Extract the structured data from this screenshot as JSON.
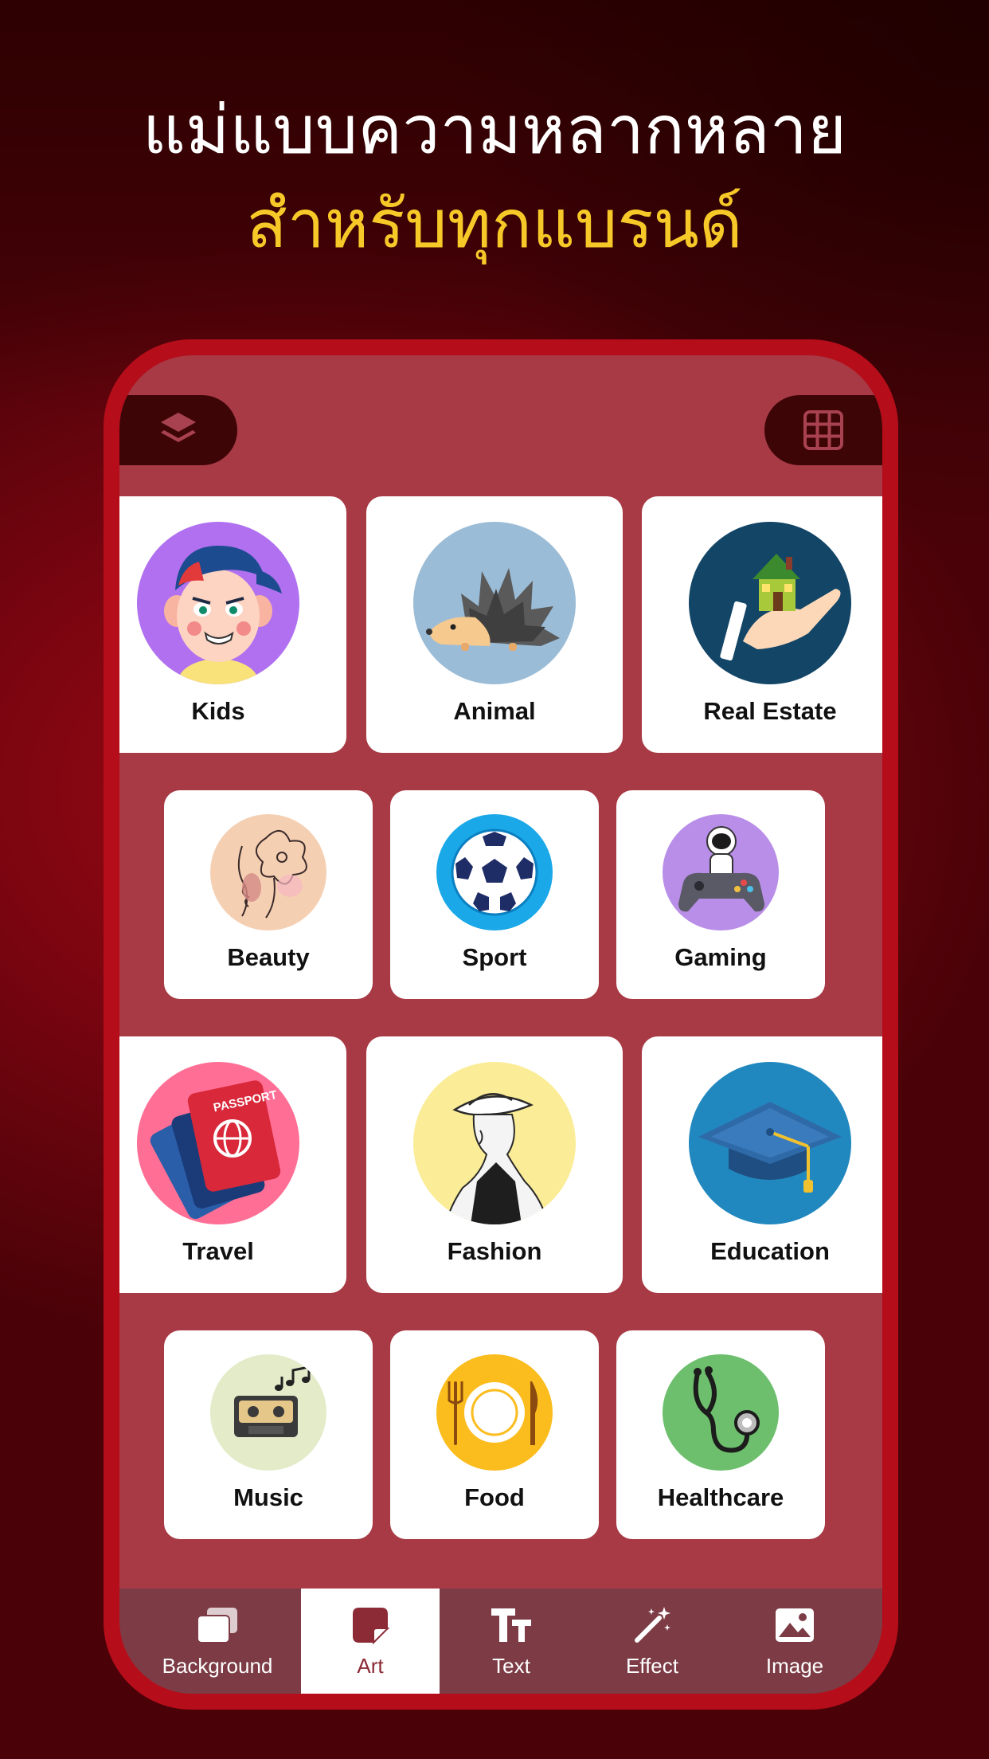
{
  "headline": {
    "line1": "แม่แบบความหลากหลาย",
    "line2": "สำหรับทุกแบรนด์"
  },
  "colors": {
    "accent_yellow": "#f7c928",
    "phone_frame": "#b50d1a",
    "screen": "#a73a45",
    "active_tab_text": "#8c2a36"
  },
  "toolbar": {
    "layers_icon": "layers-icon",
    "grid_icon": "grid-icon"
  },
  "categories": [
    {
      "label": "Kids",
      "icon": "kid-face-icon",
      "bg": "#b070f0"
    },
    {
      "label": "Animal",
      "icon": "hedgehog-icon",
      "bg": "#9bbcd6"
    },
    {
      "label": "Real Estate",
      "icon": "house-in-hand-icon",
      "bg": "#124566"
    },
    {
      "label": "Beauty",
      "icon": "face-flower-icon",
      "bg": "#f5cfb2"
    },
    {
      "label": "Sport",
      "icon": "soccer-ball-icon",
      "bg": "#1aa8e8"
    },
    {
      "label": "Gaming",
      "icon": "astronaut-gamepad-icon",
      "bg": "#b98ee8"
    },
    {
      "label": "Travel",
      "icon": "passport-icon",
      "bg": "#ff6f95"
    },
    {
      "label": "Fashion",
      "icon": "woman-hat-icon",
      "bg": "#fbec97"
    },
    {
      "label": "Education",
      "icon": "graduation-cap-icon",
      "bg": "#2188bf"
    },
    {
      "label": "Music",
      "icon": "cassette-icon",
      "bg": "#e4ebc9"
    },
    {
      "label": "Food",
      "icon": "plate-icon",
      "bg": "#fbbc1e"
    },
    {
      "label": "Healthcare",
      "icon": "stethoscope-icon",
      "bg": "#6dbf6d"
    }
  ],
  "tabs": [
    {
      "label": "Background",
      "icon": "background-icon",
      "active": false
    },
    {
      "label": "Art",
      "icon": "sticker-icon",
      "active": true
    },
    {
      "label": "Text",
      "icon": "text-icon",
      "active": false
    },
    {
      "label": "Effect",
      "icon": "magic-wand-icon",
      "active": false
    },
    {
      "label": "Image",
      "icon": "image-icon",
      "active": false
    }
  ]
}
